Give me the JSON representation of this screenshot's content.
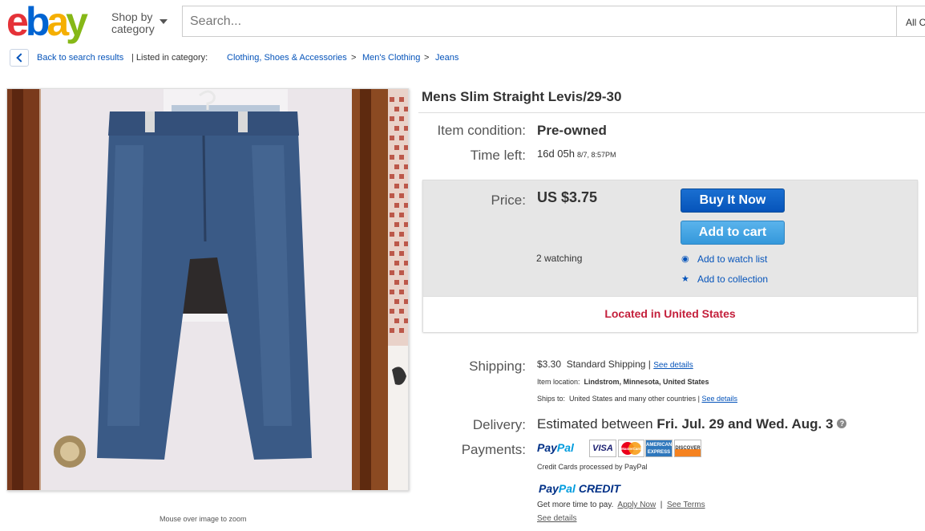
{
  "header": {
    "logo_text": "ebay",
    "shop_by_category": "Shop by category",
    "search_placeholder": "Search...",
    "all_categories": "All C"
  },
  "breadcrumb": {
    "back_label": "Back to search results",
    "listed_in": "| Listed in category:",
    "cat1": "Clothing, Shoes & Accessories",
    "cat2": "Men's Clothing",
    "cat3": "Jeans",
    "sep": ">"
  },
  "image": {
    "zoom_hint": "Mouse over image to zoom"
  },
  "item": {
    "title": "Mens Slim Straight Levis/29-30",
    "condition_label": "Item condition:",
    "condition_value": "Pre-owned",
    "time_left_label": "Time left:",
    "time_left_value": "16d 05h",
    "time_left_end": "8/7, 8:57PM"
  },
  "price_panel": {
    "price_label": "Price:",
    "price_value": "US $3.75",
    "buy_now": "Buy It Now",
    "add_to_cart": "Add to cart",
    "watching": "2 watching",
    "add_watch": "Add to watch list",
    "add_collection": "Add to collection",
    "located": "Located in United States"
  },
  "shipping": {
    "label": "Shipping:",
    "amount": "$3.30",
    "method": "Standard Shipping",
    "see_details": "See details",
    "item_location_label": "Item location:",
    "item_location": "Lindstrom, Minnesota, United States",
    "ships_to_label": "Ships to:",
    "ships_to": "United States and many other countries",
    "ships_see_details": "See details"
  },
  "delivery": {
    "label": "Delivery:",
    "prefix": "Estimated between",
    "range": "Fri. Jul. 29 and Wed. Aug. 3"
  },
  "payments": {
    "label": "Payments:",
    "paypal_pay": "Pay",
    "paypal_pal": "Pal",
    "visa": "VISA",
    "mastercard": "MasterCard",
    "amex": "AMERICAN EXPRESS",
    "discover": "DISCOVER",
    "cc_note": "Credit Cards processed by PayPal",
    "credit_word": "CREDIT",
    "more_time": "Get more time to pay.",
    "apply_now": "Apply Now",
    "see_terms": "See Terms",
    "see_details": "See details"
  },
  "colors": {
    "link": "#0654ba",
    "located_red": "#c4203c",
    "buy_button": "#0654ba",
    "cart_button": "#3498db"
  }
}
